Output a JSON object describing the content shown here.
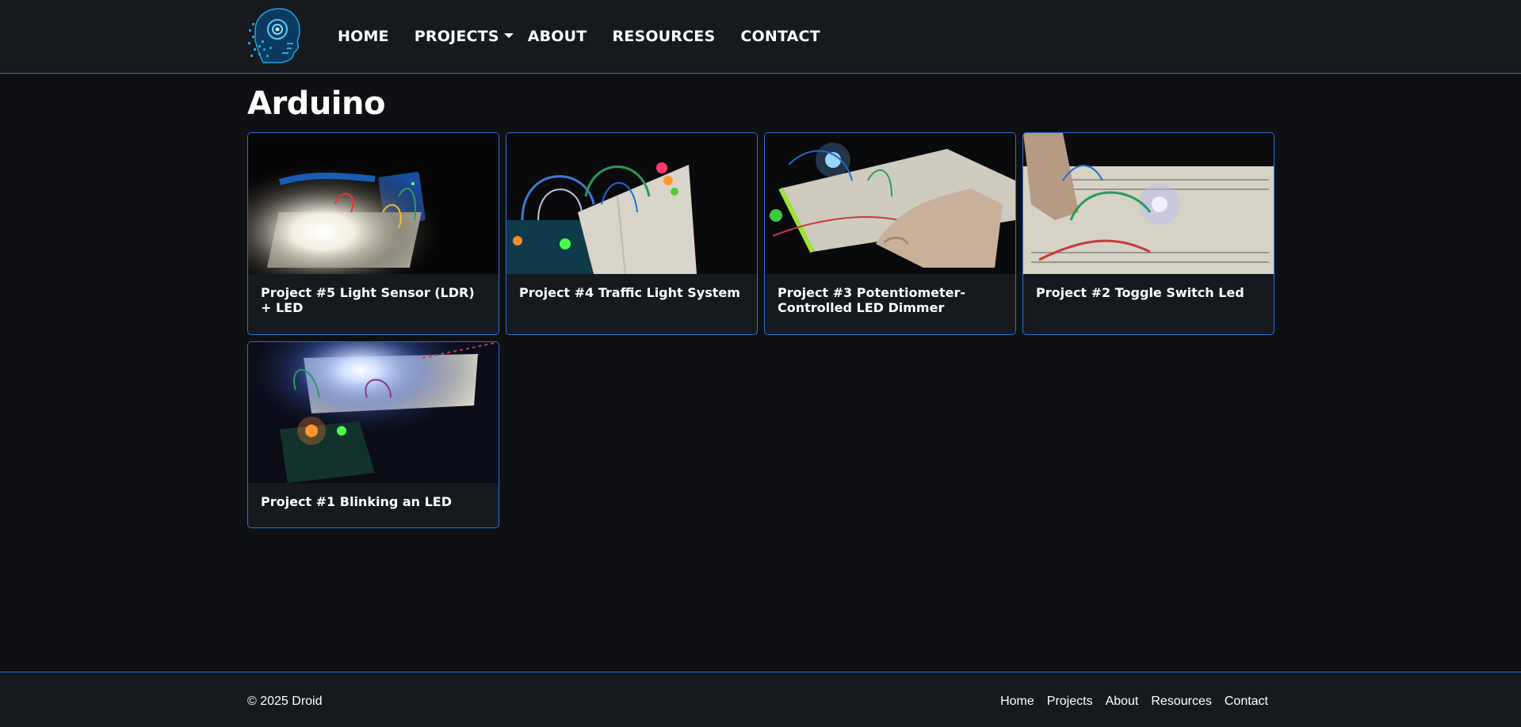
{
  "nav": {
    "items": [
      "HOME",
      "PROJECTS",
      "ABOUT",
      "RESOURCES",
      "CONTACT"
    ]
  },
  "page": {
    "title": "Arduino"
  },
  "cards": [
    {
      "title": "Project #5 Light Sensor (LDR) + LED"
    },
    {
      "title": "Project #4 Traffic Light System"
    },
    {
      "title": "Project #3 Potentiometer-Controlled LED Dimmer"
    },
    {
      "title": "Project #2 Toggle Switch Led"
    },
    {
      "title": "Project #1 Blinking an LED"
    }
  ],
  "footer": {
    "copyright": "© 2025 Droid",
    "links": [
      "Home",
      "Projects",
      "About",
      "Resources",
      "Contact"
    ]
  },
  "colors": {
    "background": "#0e1013",
    "surface": "#16191e",
    "accent": "#2f6fd6"
  }
}
